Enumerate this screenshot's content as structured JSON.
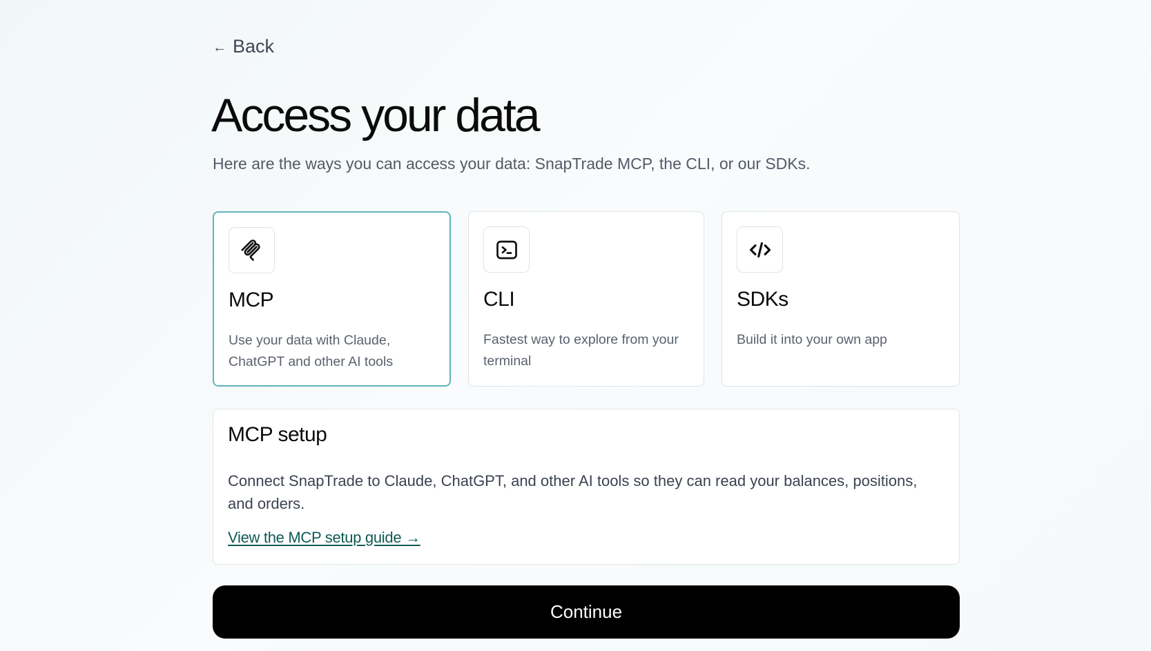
{
  "nav": {
    "back_label": "Back",
    "back_icon": "arrow-left-icon"
  },
  "header": {
    "title": "Access your data",
    "subtitle": "Here are the ways you can access your data: SnapTrade MCP, the CLI, or our SDKs."
  },
  "options": [
    {
      "icon": "mcp-icon",
      "title": "MCP",
      "description": "Use your data with Claude, ChatGPT and other AI tools",
      "selected": true
    },
    {
      "icon": "terminal-icon",
      "title": "CLI",
      "description": "Fastest way to explore from your terminal",
      "selected": false
    },
    {
      "icon": "code-icon",
      "title": "SDKs",
      "description": "Build it into your own app",
      "selected": false
    }
  ],
  "setup": {
    "title": "MCP setup",
    "description": "Connect SnapTrade to Claude, ChatGPT, and other AI tools so they can read your balances, positions, and orders.",
    "link_label": "View the MCP setup guide →"
  },
  "actions": {
    "continue_label": "Continue"
  },
  "colors": {
    "accent_border": "#5fb4bc",
    "link": "#0f5a55",
    "button_bg": "#000000"
  }
}
